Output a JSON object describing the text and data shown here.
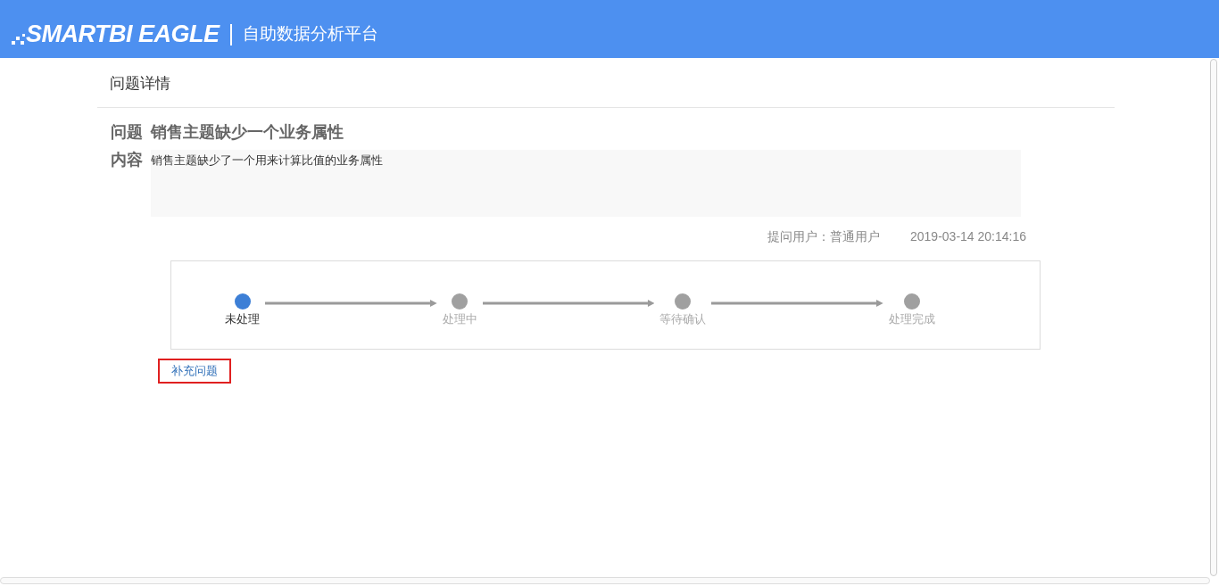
{
  "header": {
    "logo": "SMARTBI EAGLE",
    "product": "自助数据分析平台"
  },
  "page_title": "问题详情",
  "question": {
    "label": "问题",
    "value": "销售主题缺少一个业务属性"
  },
  "content": {
    "label": "内容",
    "value": "销售主题缺少了一个用来计算比值的业务属性"
  },
  "meta": {
    "asker": "提问用户：普通用户",
    "time": "2019-03-14 20:14:16"
  },
  "steps": [
    {
      "label": "未处理",
      "selected": true
    },
    {
      "label": "处理中",
      "selected": false
    },
    {
      "label": "等待确认",
      "selected": false
    },
    {
      "label": "处理完成",
      "selected": false
    }
  ],
  "action": {
    "label": "补充问题"
  }
}
